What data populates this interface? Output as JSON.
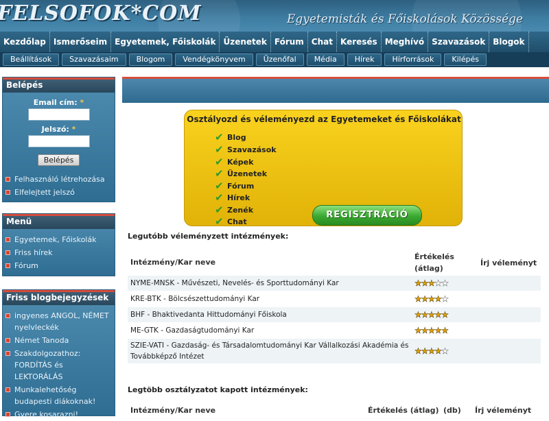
{
  "header": {
    "logo_text": "FELSOFOK*COM",
    "tagline": "Egyetemisták és Főiskolások Közössége"
  },
  "main_nav": [
    "Kezdőlap",
    "Ismerőseim",
    "Egyetemek, Főiskolák",
    "Üzenetek",
    "Fórum",
    "Chat",
    "Keresés",
    "Meghívó",
    "Szavazások",
    "Blogok"
  ],
  "sub_nav": [
    "Beállítások",
    "Szavazásaim",
    "Blogom",
    "Vendégkönyvem",
    "Üzenőfal",
    "Média",
    "Hírek",
    "Hírforrások",
    "Kilépés"
  ],
  "login": {
    "title": "Belépés",
    "email_label": "Email cím:",
    "password_label": "Jelszó:",
    "required_mark": "*",
    "button": "Belépés",
    "links": [
      "Felhasználó létrehozása",
      "Elfelejtett jelszó"
    ]
  },
  "menu": {
    "title": "Menü",
    "links": [
      "Egyetemek, Főiskolák",
      "Friss hírek",
      "Fórum"
    ]
  },
  "blog": {
    "title": "Friss blogbejegyzések",
    "links": [
      "ingyenes ANGOL, NÉMET nyelvleckék",
      "Német Tanoda",
      "Szakdolgozathoz: FORDÍTÁS és LEKTORÁLÁS",
      "Munkalehetőség budapesti diákoknak!",
      "Gyere kosarazni!"
    ]
  },
  "promo": {
    "title": "Osztályozd és véleményezd az Egyetemeket és Főiskolákat",
    "features": [
      "Blog",
      "Szavazások",
      "Képek",
      "Üzenetek",
      "Fórum",
      "Hírek",
      "Zenék",
      "Chat"
    ],
    "register_button": "REGISZTRÁCIÓ",
    "check_icon": "check-icon",
    "check_color": "#2f9a2a"
  },
  "most_reviewed": {
    "title": "Legutóbb véleményzett intézmények:",
    "col_name": "Intézmény/Kar neve",
    "col_rating": "Értékelés (átlag)",
    "col_write": "Írj véleményt",
    "rows": [
      {
        "name": "NYME-MNSK - Művészeti, Nevelés- és Sporttudományi Kar",
        "stars": 3
      },
      {
        "name": "KRE-BTK - Bölcsészettudományi Kar",
        "stars": 4
      },
      {
        "name": "BHF - Bhaktivedanta Hittudományi Főiskola",
        "stars": 5
      },
      {
        "name": "ME-GTK - Gazdaságtudományi Kar",
        "stars": 5
      },
      {
        "name": "SZIE-VATI - Gazdaság- és Társadalomtudományi Kar Vállalkozási Akadémia és Továbbképző Intézet",
        "stars": 4
      }
    ],
    "max_stars": 5
  },
  "most_rated": {
    "title": "Legtöbb osztályzatot kapott intézmények:",
    "col_name": "Intézmény/Kar neve",
    "col_rating": "Értékelés (átlag)",
    "col_count": "(db)",
    "col_write": "Írj véleményt"
  },
  "colors": {
    "header_blue": "#3f7ea3",
    "nav_dark": "#173e58",
    "accent_red": "#d94c3c",
    "promo_yellow": "#f9d21e",
    "star_gold": "#e0a300"
  }
}
